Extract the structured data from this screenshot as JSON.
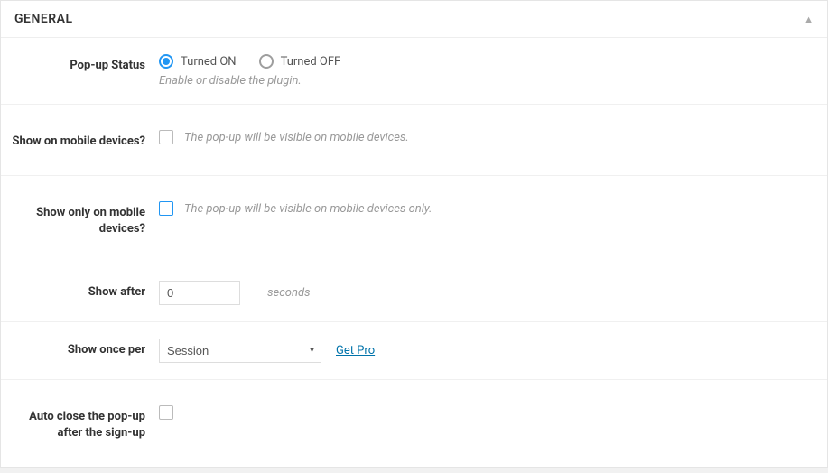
{
  "panel": {
    "title": "GENERAL"
  },
  "rows": {
    "popup_status": {
      "label": "Pop-up Status",
      "option_on": "Turned ON",
      "option_off": "Turned OFF",
      "help": "Enable or disable the plugin."
    },
    "show_mobile": {
      "label": "Show on mobile devices?",
      "help": "The pop-up will be visible on mobile devices."
    },
    "show_only_mobile": {
      "label": "Show only on mobile devices?",
      "help": "The pop-up will be visible on mobile devices only."
    },
    "show_after": {
      "label": "Show after",
      "value": "0",
      "suffix": "seconds"
    },
    "show_once_per": {
      "label": "Show once per",
      "selected": "Session",
      "link": "Get Pro"
    },
    "auto_close": {
      "label": "Auto close the pop-up after the sign-up"
    }
  }
}
